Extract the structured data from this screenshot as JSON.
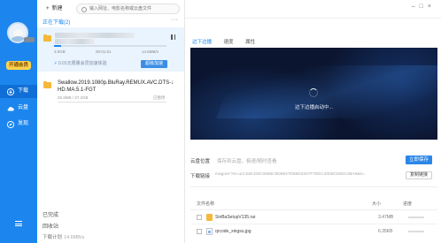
{
  "sidebar": {
    "open_vip": "开通会员",
    "items": [
      {
        "label": "下载",
        "icon": "download-icon"
      },
      {
        "label": "云盘",
        "icon": "cloud-icon"
      },
      {
        "label": "发现",
        "icon": "compass-icon"
      }
    ]
  },
  "toolbar": {
    "new_label": "新建",
    "search_placeholder": "输入网址、电影名称或云盘文件"
  },
  "downloads": {
    "section_title": "正在下载(2)",
    "task1": {
      "size_done": "3.0GB",
      "time": "00:01:51",
      "speed": "14.6MB/s",
      "progress_pct": 6,
      "promo": "0.01元限量会员加速体验",
      "accel_label": "超级加速"
    },
    "task2": {
      "name": "Swallow.2019.1080p.BluRay.REMUX.AVC.DTS-HD.MA.5.1-FGT",
      "size": "26.9MB / 27.2GB",
      "status": "已暂停"
    }
  },
  "sidebar_bottom": {
    "completed": "已完成",
    "trash": "回收站",
    "speed_label": "下载计划",
    "speed_value": "14.6MB/s"
  },
  "detail": {
    "tabs": [
      "边下边播",
      "速度",
      "属性"
    ],
    "active_tab": 0,
    "video_message": "边下边播启动中...",
    "cloud_label": "云盘位置",
    "cloud_hint": "保存到云盘，极速/随时查看",
    "save_button": "立即保存",
    "link_label": "下载链接",
    "link_url": "magnet:?xt=urn:btih:D5C0685C9D8947D69D3257F7EEC4008CD82A38A8&tr=",
    "copy_button": "复制链接",
    "table_headers": {
      "name": "文件名称",
      "size": "大小",
      "progress": "进度"
    },
    "files": [
      {
        "name": "SinBaSetupV135.rar",
        "size": "3.47MB",
        "type": "rar"
      },
      {
        "name": "qrcode_xingsu.jpg",
        "size": "6.35KB",
        "type": "jpg"
      }
    ]
  },
  "colors": {
    "sidebar_blue": "#1c86ee",
    "accent": "#1c86ee",
    "vip_yellow": "#ffd24d"
  }
}
